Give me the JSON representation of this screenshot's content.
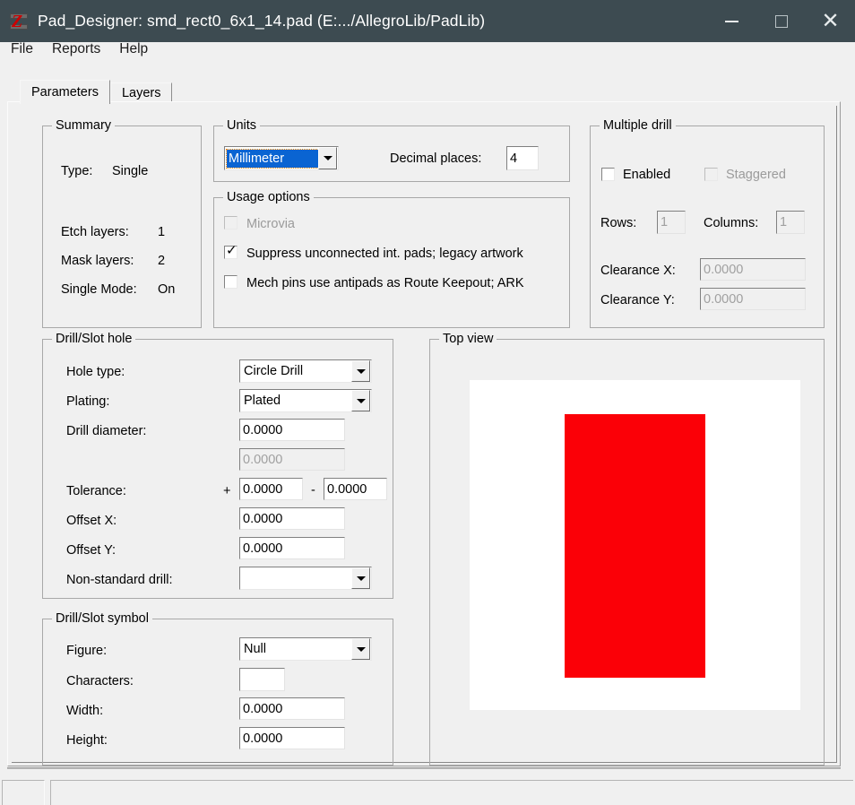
{
  "window": {
    "title": "Pad_Designer: smd_rect0_6x1_14.pad (E:.../AllegroLib/PadLib)",
    "icon": "pad-designer-icon",
    "controls": {
      "minimize": "minimize-icon",
      "maximize": "maximize-icon",
      "close": "close-icon"
    }
  },
  "menubar": {
    "items": [
      {
        "label": "File"
      },
      {
        "label": "Reports"
      },
      {
        "label": "Help"
      }
    ]
  },
  "tabs": [
    {
      "label": "Parameters",
      "active": true
    },
    {
      "label": "Layers",
      "active": false
    }
  ],
  "summary": {
    "legend": "Summary",
    "rows": [
      {
        "label": "Type:",
        "value": "Single"
      },
      {
        "label": "Etch layers:",
        "value": "1"
      },
      {
        "label": "Mask layers:",
        "value": "2"
      },
      {
        "label": "Single Mode:",
        "value": "On"
      }
    ]
  },
  "units": {
    "legend": "Units",
    "selected": "Millimeter",
    "decimal_places_label": "Decimal places:",
    "decimal_places_value": "4"
  },
  "usage_options": {
    "legend": "Usage options",
    "items": [
      {
        "label": "Microvia",
        "checked": false,
        "disabled": true
      },
      {
        "label": "Suppress unconnected int. pads; legacy artwork",
        "checked": true,
        "disabled": false
      },
      {
        "label": "Mech pins use antipads as Route Keepout; ARK",
        "checked": false,
        "disabled": false
      }
    ]
  },
  "multiple_drill": {
    "legend": "Multiple drill",
    "enabled_label": "Enabled",
    "enabled_checked": false,
    "staggered_label": "Staggered",
    "staggered_checked": false,
    "staggered_disabled": true,
    "rows_label": "Rows:",
    "rows_value": "1",
    "columns_label": "Columns:",
    "columns_value": "1",
    "clearance_x_label": "Clearance X:",
    "clearance_x_value": "0.0000",
    "clearance_y_label": "Clearance Y:",
    "clearance_y_value": "0.0000"
  },
  "drill_slot_hole": {
    "legend": "Drill/Slot hole",
    "hole_type_label": "Hole type:",
    "hole_type_value": "Circle Drill",
    "plating_label": "Plating:",
    "plating_value": "Plated",
    "drill_diameter_label": "Drill diameter:",
    "drill_diameter_value": "0.0000",
    "drill_diameter_secondary_value": "0.0000",
    "tolerance_label": "Tolerance:",
    "tolerance_plus_sign": "+",
    "tolerance_plus_value": "0.0000",
    "tolerance_minus_sign": "-",
    "tolerance_minus_value": "0.0000",
    "offset_x_label": "Offset X:",
    "offset_x_value": "0.0000",
    "offset_y_label": "Offset Y:",
    "offset_y_value": "0.0000",
    "non_standard_drill_label": "Non-standard drill:",
    "non_standard_drill_value": ""
  },
  "drill_slot_symbol": {
    "legend": "Drill/Slot symbol",
    "figure_label": "Figure:",
    "figure_value": "Null",
    "characters_label": "Characters:",
    "characters_value": "",
    "width_label": "Width:",
    "width_value": "0.0000",
    "height_label": "Height:",
    "height_value": "0.0000"
  },
  "top_view": {
    "legend": "Top view",
    "canvas_color": "#ffffff",
    "pad_color": "#fb0007",
    "pad_shape": "rectangle"
  },
  "statusbar": {
    "left_cell": "",
    "message": ""
  },
  "colors": {
    "titlebar": "#3d4b51",
    "window_bg": "#f0f0f0",
    "selection_blue": "#0a64d2",
    "focus_orange": "#ff8a00",
    "pad_red": "#fb0007"
  }
}
